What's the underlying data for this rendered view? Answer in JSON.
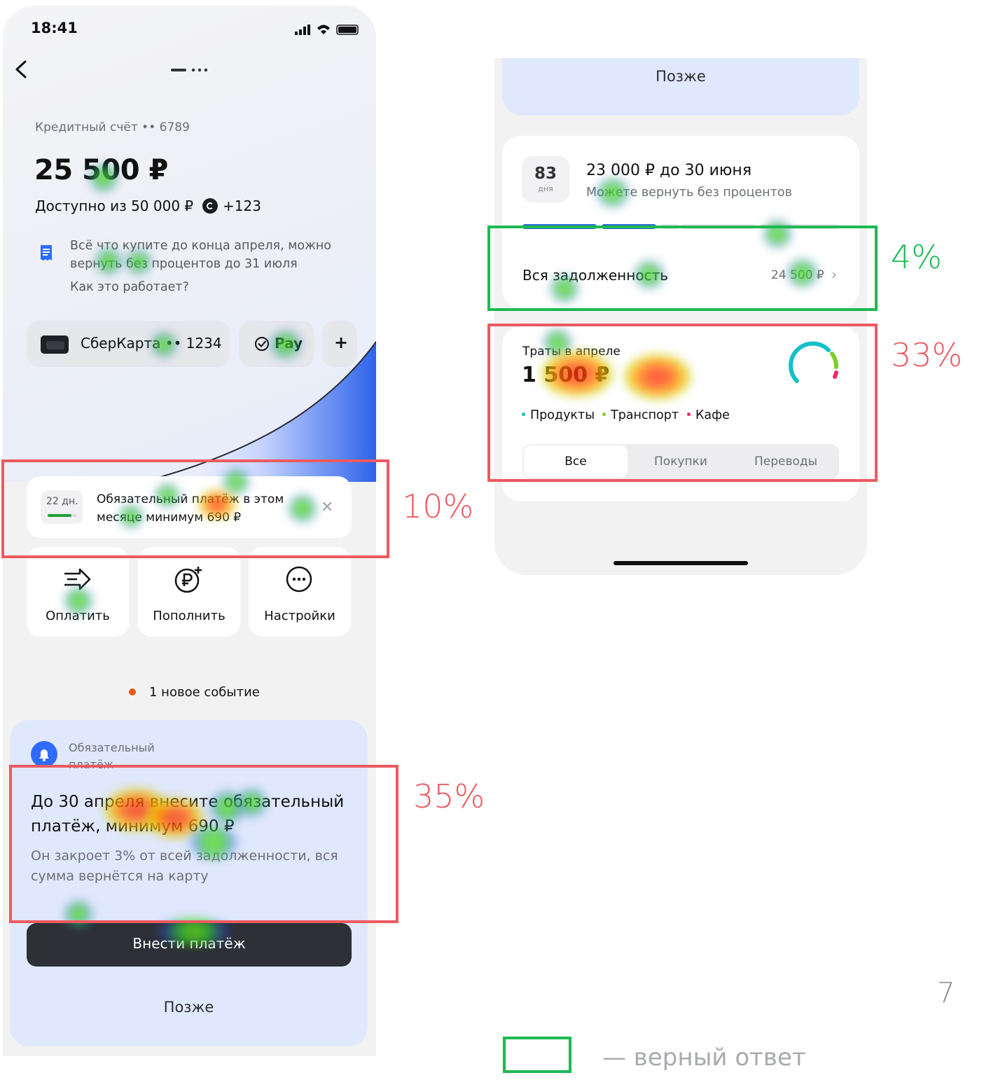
{
  "status_bar": {
    "time": "18:41"
  },
  "account": {
    "label": "Кредитный счёт •• 6789",
    "balance": "25 500 ₽",
    "available": "Доступно из 50 000 ₽",
    "bonus": "+123",
    "promo_text": "Всё что купите до конца апреля, можно вернуть без процентов до 31 июля",
    "promo_link": "Как это работает?"
  },
  "chips": {
    "card_label": "СберКарта •• 1234",
    "pay_label": "Pay",
    "plus_label": "+"
  },
  "mini_banner": {
    "days": "22 дн.",
    "text": "Обязательный платёж в этом месяце минимум 690 ₽",
    "close": "✕",
    "progress": 0.8
  },
  "actions": [
    {
      "label": "Оплатить",
      "icon": "pay-arrow-icon"
    },
    {
      "label": "Пополнить",
      "icon": "topup-ruble-icon"
    },
    {
      "label": "Настройки",
      "icon": "settings-dots-icon"
    }
  ],
  "event": {
    "text": "1 новое событие",
    "color": "#e85a18"
  },
  "notice": {
    "tag": "Обязательный платёж",
    "title": "До 30 апреля внесите обязательный платёж, минимум 690 ₽",
    "subtitle": "Он закроет 3% от всей задолженности, вся сумма вернётся на карту",
    "button": "Внести платёж",
    "later": "Позже"
  },
  "right_screen": {
    "later": "Позже",
    "grace": {
      "days": "83",
      "days_unit": "дня",
      "title": "23 000 ₽ до 30 июня",
      "subtitle": "Можете вернуть без процентов"
    },
    "debt": {
      "label": "Вся задолженность",
      "value": "24 500 ₽",
      "chevron": "›"
    },
    "spending": {
      "title": "Траты в апреле",
      "sum": "1 500 ₽",
      "categories": [
        {
          "label": "Продукты",
          "color": "#13c0c8"
        },
        {
          "label": "Транспорт",
          "color": "#7ccf2a"
        },
        {
          "label": "Кафе",
          "color": "#ee2a6a"
        }
      ],
      "tabs": [
        "Все",
        "Покупки",
        "Переводы"
      ],
      "active_tab": "Все"
    }
  },
  "overlays": {
    "pct_mini_banner": "10%",
    "pct_notice": "35%",
    "pct_debt": "4%",
    "pct_spending": "33%",
    "page_number": "7",
    "legend_caption": "— верный ответ",
    "accent_red": "#ec5a5f",
    "accent_green": "#1db954"
  }
}
